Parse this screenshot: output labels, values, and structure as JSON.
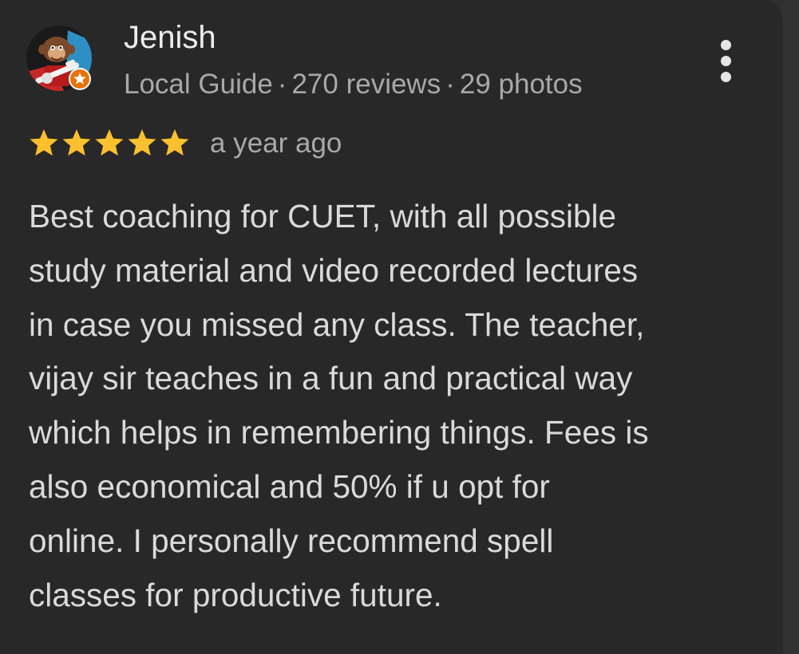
{
  "review": {
    "author": {
      "name": "Jenish",
      "badge_icon": "local-guide-star-icon",
      "avatar": "cartoon-monkey-guitar-avatar"
    },
    "meta": {
      "role": "Local Guide",
      "reviews": "270 reviews",
      "photos": "29 photos",
      "separator": "·"
    },
    "rating": {
      "value": 5,
      "max": 5,
      "star_color": "#fbc02d"
    },
    "date": "a year ago",
    "text_lines": [
      "Best coaching for CUET, with all possible",
      "study material and video recorded lectures",
      "in case you missed any class. The teacher,",
      "vijay sir teaches in a fun and practical way",
      "which helps in remembering things. Fees is",
      "also economical and 50% if u opt for",
      "online. I personally recommend spell",
      "classes for productive future."
    ],
    "menu_icon": "more-vert-icon"
  },
  "colors": {
    "card_bg": "#282828",
    "name": "#ededed",
    "secondary": "#a9a9a9",
    "body": "#dadada",
    "badge": "#e8710a"
  }
}
